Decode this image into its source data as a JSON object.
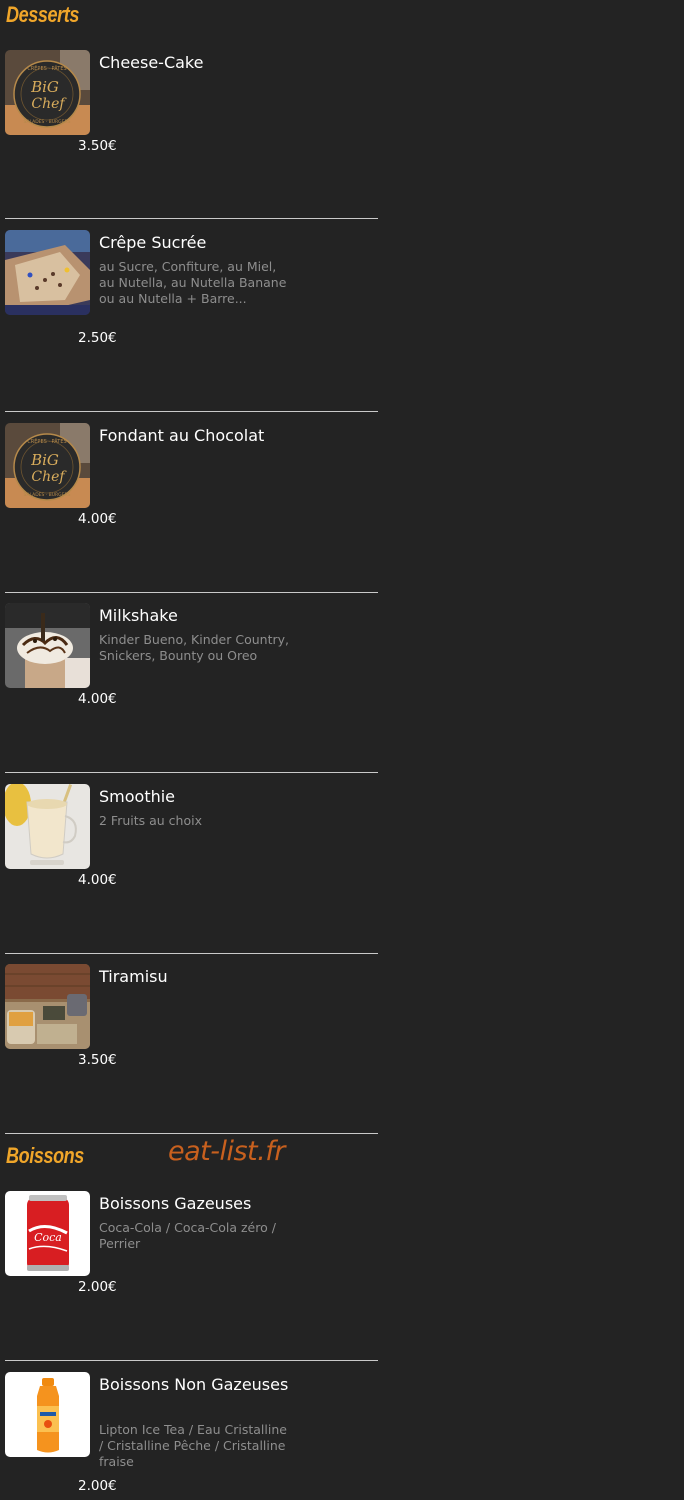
{
  "sections": {
    "desserts_title": "Desserts",
    "boissons_title": "Boissons",
    "watermark": "eat-list.fr"
  },
  "items": [
    {
      "name": "Cheese-Cake",
      "desc": "",
      "price": "3.50€",
      "icon": "big-chef-logo-image"
    },
    {
      "name": "Crêpe Sucrée",
      "desc": "au Sucre, Confiture, au Miel, au Nutella, au Nutella Banane ou au Nutella + Barre...",
      "price": "2.50€",
      "icon": "crepe-image"
    },
    {
      "name": "Fondant au Chocolat",
      "desc": "",
      "price": "4.00€",
      "icon": "big-chef-logo-image"
    },
    {
      "name": "Milkshake",
      "desc": "Kinder Bueno, Kinder Country, Snickers, Bounty ou Oreo",
      "price": "4.00€",
      "icon": "milkshake-image"
    },
    {
      "name": "Smoothie",
      "desc": "2 Fruits au choix",
      "price": "4.00€",
      "icon": "smoothie-image"
    },
    {
      "name": "Tiramisu",
      "desc": "",
      "price": "3.50€",
      "icon": "tiramisu-image"
    },
    {
      "name": "Boissons Gazeuses",
      "desc": "Coca-Cola / Coca-Cola zéro / Perrier",
      "price": "2.00€",
      "icon": "coca-cola-can-image"
    },
    {
      "name": "Boissons Non Gazeuses",
      "desc": "Lipton Ice Tea  / Eau Cristalline / Cristalline Pêche / Cristalline fraise",
      "price": "2.00€",
      "icon": "orange-bottle-image"
    }
  ],
  "logo_text": {
    "big": "BiG",
    "chef": "Chef",
    "ring_top": "CRÊPES · PÂTES",
    "ring_bottom": "SALADES · BURGERS"
  },
  "colors": {
    "background": "#232323",
    "section_title": "#f0a62a",
    "watermark": "#c8601e",
    "description": "#8e8e8e",
    "divider": "#c9c9c9"
  }
}
